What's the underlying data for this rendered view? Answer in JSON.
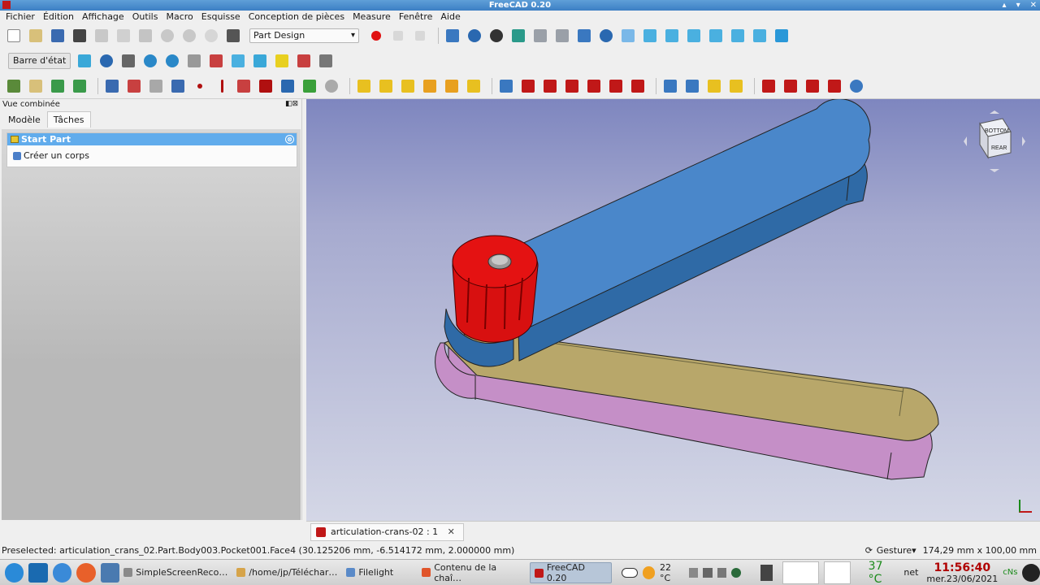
{
  "window": {
    "title": "FreeCAD 0.20",
    "buttons": [
      "▴",
      "▾",
      "✕"
    ]
  },
  "menu": [
    "Fichier",
    "Édition",
    "Affichage",
    "Outils",
    "Macro",
    "Esquisse",
    "Conception de pièces",
    "Measure",
    "Fenêtre",
    "Aide"
  ],
  "toolbar1": {
    "workbench": "Part Design"
  },
  "toolbar2": {
    "status_button": "Barre d'état"
  },
  "panel": {
    "title": "Vue combinée",
    "header_buttons": "◧⊠",
    "tabs": [
      "Modèle",
      "Tâches"
    ],
    "task": {
      "header": "Start Part",
      "close": "⊗",
      "item": "Créer un corps"
    }
  },
  "document_tab": {
    "label": "articulation-crans-02 : 1",
    "close": "✕"
  },
  "navcube": {
    "face_top": "BOTTOM",
    "face_front": "REAR"
  },
  "status": {
    "preselected": "Preselected: articulation_crans_02.Part.Body003.Pocket001.Face4 (30.125206 mm, -6.514172 mm, 2.000000 mm)",
    "nav_style": "Gesture▾",
    "dimensions": "174,29 mm x 100,00 mm"
  },
  "taskbar": {
    "tasks": [
      {
        "label": "SimpleScreenReco…",
        "color": "#8a8a8a"
      },
      {
        "label": "/home/jp/Téléchar…",
        "color": "#d6a44a"
      },
      {
        "label": "Filelight",
        "color": "#5a8ac8"
      },
      {
        "label": "Contenu de la chaî…",
        "color": "#e0542a"
      },
      {
        "label": "FreeCAD 0.20",
        "color": "#c01818"
      }
    ],
    "weather": "22 °C",
    "cpu_temp": "37 °C",
    "net": "net",
    "clock": "11:56:40",
    "date": "mer.23/06/2021",
    "cns": "cNs"
  },
  "colors": {
    "arm_top": "#4a87ca",
    "arm_bottom": "#bba86a",
    "knob": "#e01010",
    "viewport_bg": "#a6aacf"
  }
}
